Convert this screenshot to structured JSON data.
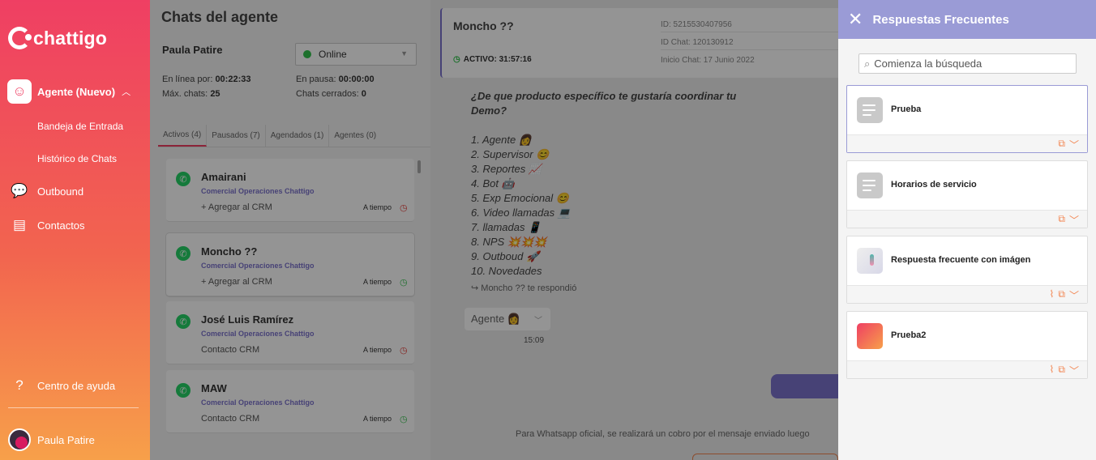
{
  "sidebar": {
    "brand": "chattigo",
    "main_item": "Agente (Nuevo)",
    "sub_items": [
      "Bandeja de Entrada",
      "Histórico de Chats"
    ],
    "items": [
      "Outbound",
      "Contactos"
    ],
    "help": "Centro de ayuda",
    "user": "Paula Patire"
  },
  "list": {
    "title": "Chats del agente",
    "agent": "Paula Patire",
    "status": "Online",
    "online_label": "En línea por:",
    "online_value": "00:22:33",
    "pause_label": "En pausa:",
    "pause_value": "00:00:00",
    "max_label": "Máx. chats:",
    "max_value": "25",
    "closed_label": "Chats cerrados:",
    "closed_value": "0",
    "tabs": [
      "Activos (4)",
      "Pausados (7)",
      "Agendados (1)",
      "Agentes (0)"
    ],
    "chats": [
      {
        "name": "Amairani",
        "team": "Comercial Operaciones Chattigo",
        "link": "+ Agregar al CRM",
        "time": "A tiempo",
        "clock_color": "#e53935"
      },
      {
        "name": "Moncho ??",
        "team": "Comercial Operaciones Chattigo",
        "link": "+ Agregar al CRM",
        "time": "A tiempo",
        "clock_color": "#33c24d"
      },
      {
        "name": "José Luis Ramírez",
        "team": "Comercial Operaciones Chattigo",
        "link": "Contacto CRM",
        "time": "A tiempo",
        "clock_color": "#e53935"
      },
      {
        "name": "MAW",
        "team": "Comercial Operaciones Chattigo",
        "link": "Contacto CRM",
        "time": "A tiempo",
        "clock_color": "#33c24d"
      }
    ]
  },
  "chat": {
    "name": "Moncho ??",
    "active": "ACTIVO: 31:57:16",
    "id": "ID: 5215530407956",
    "id_chat": "ID Chat: 120130912",
    "start": "Inicio Chat: 17 Junio 2022",
    "question_1": "¿De que producto específico te gustaría coordinar tu",
    "question_2": "Demo?",
    "options": [
      "1. Agente 👩",
      "2. Supervisor 😊",
      "3. Reportes 📈",
      "4. Bot 🤖",
      "5. Exp Emocional 😊",
      "6. Video llamadas 💻",
      "7. llamadas 📱",
      "8. NPS 💥💥💥",
      "9. Outboud 🚀",
      "10. Novedades"
    ],
    "reply": "Moncho ?? te respondió",
    "quick_reply": "Agente 👩",
    "msg_time": "15:09",
    "footer": "Para Whatsapp oficial, se realizará un cobro por el mensaje enviado luego"
  },
  "drawer": {
    "title": "Respuestas Frecuentes",
    "search_placeholder": "Comienza la búsqueda",
    "responses": [
      {
        "label": "Prueba",
        "thumb": "lines",
        "attachment": false
      },
      {
        "label": "Horarios de servicio",
        "thumb": "lines",
        "attachment": false
      },
      {
        "label": "Respuesta frecuente con imágen",
        "thumb": "image",
        "attachment": true
      },
      {
        "label": "Prueba2",
        "thumb": "orange",
        "attachment": true
      }
    ]
  }
}
